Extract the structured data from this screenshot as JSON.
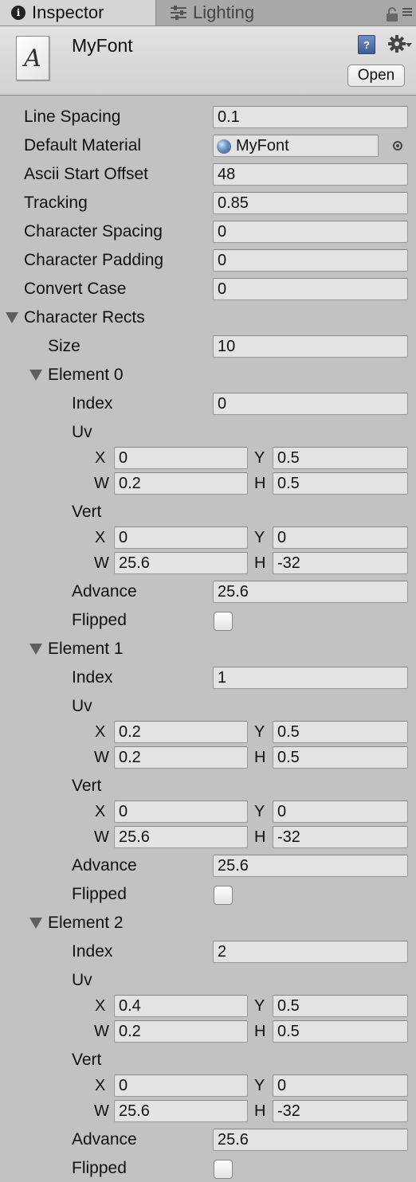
{
  "tabs": [
    {
      "label": "Inspector",
      "icon": "info-icon"
    },
    {
      "label": "Lighting",
      "icon": "sliders-icon"
    }
  ],
  "header": {
    "asset_name": "MyFont",
    "file_icon_letter": "A",
    "open_label": "Open",
    "help_glyph": "?"
  },
  "properties": {
    "line_spacing": {
      "label": "Line Spacing",
      "value": "0.1"
    },
    "default_material": {
      "label": "Default Material",
      "value": "MyFont"
    },
    "ascii_start_offset": {
      "label": "Ascii Start Offset",
      "value": "48"
    },
    "tracking": {
      "label": "Tracking",
      "value": "0.85"
    },
    "character_spacing": {
      "label": "Character Spacing",
      "value": "0"
    },
    "character_padding": {
      "label": "Character Padding",
      "value": "0"
    },
    "convert_case": {
      "label": "Convert Case",
      "value": "0"
    }
  },
  "character_rects": {
    "label": "Character Rects",
    "size_label": "Size",
    "size": "10",
    "labels": {
      "index": "Index",
      "uv": "Uv",
      "vert": "Vert",
      "advance": "Advance",
      "flipped": "Flipped",
      "x": "X",
      "y": "Y",
      "w": "W",
      "h": "H"
    },
    "elements": [
      {
        "label": "Element 0",
        "index": "0",
        "uv": {
          "x": "0",
          "y": "0.5",
          "w": "0.2",
          "h": "0.5"
        },
        "vert": {
          "x": "0",
          "y": "0",
          "w": "25.6",
          "h": "-32"
        },
        "advance": "25.6",
        "flipped": false
      },
      {
        "label": "Element 1",
        "index": "1",
        "uv": {
          "x": "0.2",
          "y": "0.5",
          "w": "0.2",
          "h": "0.5"
        },
        "vert": {
          "x": "0",
          "y": "0",
          "w": "25.6",
          "h": "-32"
        },
        "advance": "25.6",
        "flipped": false
      },
      {
        "label": "Element 2",
        "index": "2",
        "uv": {
          "x": "0.4",
          "y": "0.5",
          "w": "0.2",
          "h": "0.5"
        },
        "vert": {
          "x": "0",
          "y": "0",
          "w": "25.6",
          "h": "-32"
        },
        "advance": "25.6",
        "flipped": false
      }
    ]
  }
}
